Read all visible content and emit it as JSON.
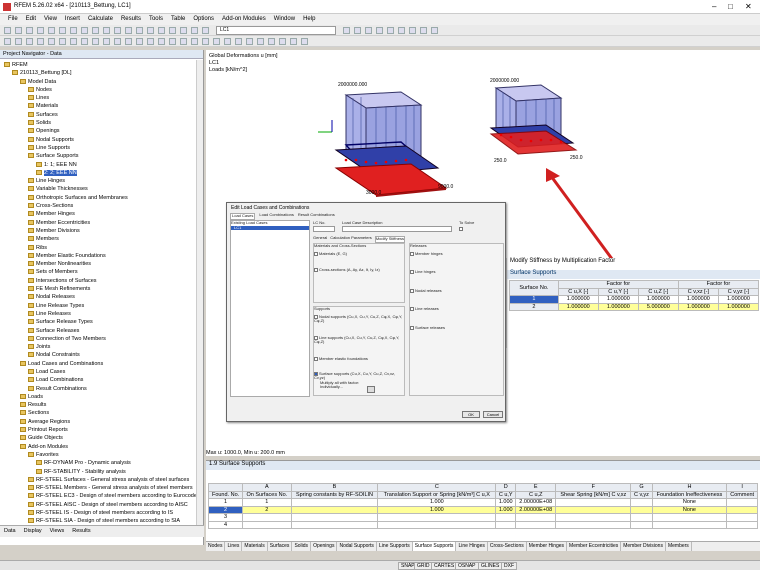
{
  "window": {
    "title": "RFEM 5.26.02 x64 - [210113_Bettung, LC1]"
  },
  "menu": [
    "File",
    "Edit",
    "View",
    "Insert",
    "Calculate",
    "Results",
    "Tools",
    "Table",
    "Options",
    "Add-on Modules",
    "Window",
    "Help"
  ],
  "toolbar": {
    "load_case": "LC1"
  },
  "navigator": {
    "title": "Project Navigator - Data",
    "items": [
      {
        "label": "RFEM",
        "level": 0
      },
      {
        "label": "210113_Bettung [DL]",
        "level": 1
      },
      {
        "label": "Model Data",
        "level": 2
      },
      {
        "label": "Nodes",
        "level": 3
      },
      {
        "label": "Lines",
        "level": 3
      },
      {
        "label": "Materials",
        "level": 3
      },
      {
        "label": "Surfaces",
        "level": 3
      },
      {
        "label": "Solids",
        "level": 3
      },
      {
        "label": "Openings",
        "level": 3
      },
      {
        "label": "Nodal Supports",
        "level": 3
      },
      {
        "label": "Line Supports",
        "level": 3
      },
      {
        "label": "Surface Supports",
        "level": 3
      },
      {
        "label": "1: 1; EEE NN",
        "level": 4
      },
      {
        "label": "2: 2; EEE NN",
        "level": 4,
        "selected": true
      },
      {
        "label": "Line Hinges",
        "level": 3
      },
      {
        "label": "Variable Thicknesses",
        "level": 3
      },
      {
        "label": "Orthotropic Surfaces and Membranes",
        "level": 3
      },
      {
        "label": "Cross-Sections",
        "level": 3
      },
      {
        "label": "Member Hinges",
        "level": 3
      },
      {
        "label": "Member Eccentricities",
        "level": 3
      },
      {
        "label": "Member Divisions",
        "level": 3
      },
      {
        "label": "Members",
        "level": 3
      },
      {
        "label": "Ribs",
        "level": 3
      },
      {
        "label": "Member Elastic Foundations",
        "level": 3
      },
      {
        "label": "Member Nonlinearities",
        "level": 3
      },
      {
        "label": "Sets of Members",
        "level": 3
      },
      {
        "label": "Intersections of Surfaces",
        "level": 3
      },
      {
        "label": "FE Mesh Refinements",
        "level": 3
      },
      {
        "label": "Nodal Releases",
        "level": 3
      },
      {
        "label": "Line Release Types",
        "level": 3
      },
      {
        "label": "Line Releases",
        "level": 3
      },
      {
        "label": "Surface Release Types",
        "level": 3
      },
      {
        "label": "Surface Releases",
        "level": 3
      },
      {
        "label": "Connection of Two Members",
        "level": 3
      },
      {
        "label": "Joints",
        "level": 3
      },
      {
        "label": "Nodal Constraints",
        "level": 3
      },
      {
        "label": "Load Cases and Combinations",
        "level": 2
      },
      {
        "label": "Load Cases",
        "level": 3
      },
      {
        "label": "Load Combinations",
        "level": 3
      },
      {
        "label": "Result Combinations",
        "level": 3
      },
      {
        "label": "Loads",
        "level": 2
      },
      {
        "label": "Results",
        "level": 2
      },
      {
        "label": "Sections",
        "level": 2
      },
      {
        "label": "Average Regions",
        "level": 2
      },
      {
        "label": "Printout Reports",
        "level": 2
      },
      {
        "label": "Guide Objects",
        "level": 2
      },
      {
        "label": "Add-on Modules",
        "level": 2
      },
      {
        "label": "Favorites",
        "level": 3
      },
      {
        "label": "RF-DYNAM Pro - Dynamic analysis",
        "level": 4
      },
      {
        "label": "RF-STABILITY - Stability analysis",
        "level": 4
      },
      {
        "label": "RF-STEEL Surfaces - General stress analysis of steel surfaces",
        "level": 3
      },
      {
        "label": "RF-STEEL Members - General stress analysis of steel members",
        "level": 3
      },
      {
        "label": "RF-STEEL EC3 - Design of steel members according to Eurocode",
        "level": 3
      },
      {
        "label": "RF-STEEL AISC - Design of steel members according to AISC",
        "level": 3
      },
      {
        "label": "RF-STEEL IS - Design of steel members according to IS",
        "level": 3
      },
      {
        "label": "RF-STEEL SIA - Design of steel members according to SIA",
        "level": 3
      },
      {
        "label": "RF-STEEL BS - Design of steel members according to BS",
        "level": 3
      }
    ],
    "tabs": [
      "Data",
      "Display",
      "Views",
      "Results"
    ]
  },
  "view": {
    "annotation": [
      "Global Deformations u [mm]",
      "LC1",
      "Loads [kN/m^2]"
    ],
    "labels_left": [
      "2000000.000",
      "9000.0",
      "3000.0"
    ],
    "labels_right": [
      "2000000.000",
      "250.0",
      "250.0"
    ],
    "footer": "Max u: 1000.0, Min u: 200.0 mm"
  },
  "modify_panel": {
    "title": "Modify Stiffness by Multiplication Factor",
    "subtitle": "Surface Supports",
    "group1": "Factor for",
    "group2": "Factor for",
    "headers": [
      "Surface No.",
      "C u,X [-]",
      "C u,Y [-]",
      "C u,Z [-]",
      "C v,xz [-]",
      "C v,yz [-]"
    ],
    "rows": [
      [
        "1",
        "1.000000",
        "1.000000",
        "1.000000",
        "1.000000",
        "1.000000"
      ],
      [
        "2",
        "1.000000",
        "1.000000",
        "5.000000",
        "1.000000",
        "1.000000"
      ]
    ]
  },
  "dialog": {
    "title": "Edit Load Cases and Combinations",
    "tabs": [
      "Load Cases",
      "Load Combinations",
      "Result Combinations"
    ],
    "existing_label": "Existing Load Cases",
    "existing_item": "LC1",
    "lc_no_label": "LC No.",
    "lc_desc_label": "Load Case Description",
    "to_solve_label": "To Solve",
    "subtabs": [
      "General",
      "Calculation Parameters",
      "Modify Stiffness"
    ],
    "left_group": "Materials and Cross-Sections",
    "left_items": [
      "Materials (E, G)",
      "Cross-sections (A, Ay, Az, It, Iy, Iz)"
    ],
    "supports_group": "Supports",
    "support_items": [
      "Nodal supports (Cu,X, Cu,Y, Cu,Z, Cφ,X, Cφ,Y, Cφ,Z)",
      "Line supports (Cu,X, Cu,Y, Cu,Z, Cφ,X, Cφ,Y, Cφ,Z)",
      "Member elastic foundations",
      "Surface supports (Cu,X, Cu,Y, Cu,Z, Cv,xz, Cv,yz)"
    ],
    "surf_options": [
      "Multiply all with factor:",
      "Individually..."
    ],
    "releases_group": "Releases",
    "release_items": [
      "Member hinges",
      "Line hinges",
      "Nodal releases",
      "Line releases",
      "Surface releases"
    ],
    "buttons": [
      "OK",
      "Cancel"
    ]
  },
  "bottom_table": {
    "title": "1.9 Surface Supports",
    "cols": [
      "A",
      "B",
      "C",
      "D",
      "E",
      "F",
      "G",
      "H",
      "I"
    ],
    "headers": [
      "Found. No.",
      "On Surfaces No.",
      "Spring constants by RF-SOILIN",
      "Translation Support or Spring [kN/m³] C u,X",
      "C u,Y",
      "C u,Z",
      "Shear Spring [kN/m] C v,xz",
      "C v,yz",
      "Foundation Ineffectiveness",
      "Comment"
    ],
    "rows": [
      [
        "1",
        "1",
        "",
        "1.000",
        "1.000",
        "2.00000E+08",
        "",
        "",
        "None",
        ""
      ],
      [
        "2",
        "2",
        "",
        "1.000",
        "1.000",
        "2.00000E+08",
        "",
        "",
        "None",
        ""
      ],
      [
        "3",
        "",
        "",
        "",
        "",
        "",
        "",
        "",
        "",
        ""
      ],
      [
        "4",
        "",
        "",
        "",
        "",
        "",
        "",
        "",
        "",
        ""
      ]
    ],
    "tabs": [
      "Nodes",
      "Lines",
      "Materials",
      "Surfaces",
      "Solids",
      "Openings",
      "Nodal Supports",
      "Line Supports",
      "Surface Supports",
      "Line Hinges",
      "Cross-Sections",
      "Member Hinges",
      "Member Eccentricities",
      "Member Divisions",
      "Members"
    ]
  },
  "statusbar": [
    "SNAP",
    "GRID",
    "CARTES",
    "OSNAP",
    "GLINES",
    "DXF"
  ]
}
